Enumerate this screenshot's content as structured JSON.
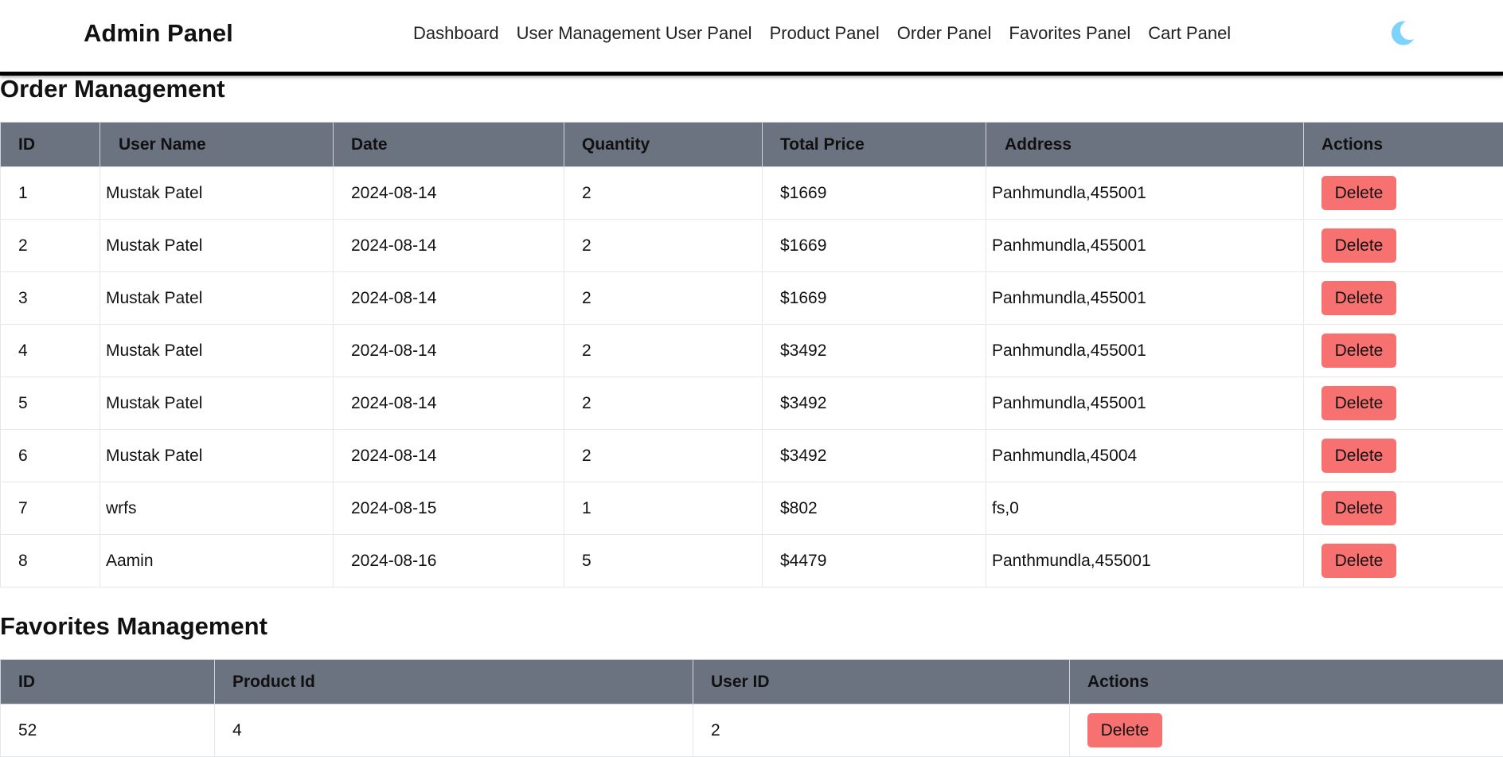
{
  "header": {
    "brand": "Admin Panel",
    "nav": [
      "Dashboard",
      "User Management User Panel",
      "Product Panel",
      "Order Panel",
      "Favorites Panel",
      "Cart Panel"
    ],
    "theme_icon": "moon-icon",
    "theme_color": "#7dd3fc"
  },
  "orders": {
    "title": "Order Management",
    "columns": [
      "ID",
      "User Name",
      "Date",
      "Quantity",
      "Total Price",
      "Address",
      "Actions"
    ],
    "rows": [
      {
        "id": "1",
        "user": "Mustak Patel",
        "date": "2024-08-14",
        "qty": "2",
        "price": "$1669",
        "address": "Panhmundla,455001",
        "action": "Delete"
      },
      {
        "id": "2",
        "user": "Mustak Patel",
        "date": "2024-08-14",
        "qty": "2",
        "price": "$1669",
        "address": "Panhmundla,455001",
        "action": "Delete"
      },
      {
        "id": "3",
        "user": "Mustak Patel",
        "date": "2024-08-14",
        "qty": "2",
        "price": "$1669",
        "address": "Panhmundla,455001",
        "action": "Delete"
      },
      {
        "id": "4",
        "user": "Mustak Patel",
        "date": "2024-08-14",
        "qty": "2",
        "price": "$3492",
        "address": "Panhmundla,455001",
        "action": "Delete"
      },
      {
        "id": "5",
        "user": "Mustak Patel",
        "date": "2024-08-14",
        "qty": "2",
        "price": "$3492",
        "address": "Panhmundla,455001",
        "action": "Delete"
      },
      {
        "id": "6",
        "user": "Mustak Patel",
        "date": "2024-08-14",
        "qty": "2",
        "price": "$3492",
        "address": "Panhmundla,45004",
        "action": "Delete"
      },
      {
        "id": "7",
        "user": "wrfs",
        "date": "2024-08-15",
        "qty": "1",
        "price": "$802",
        "address": "fs,0",
        "action": "Delete"
      },
      {
        "id": "8",
        "user": "Aamin",
        "date": "2024-08-16",
        "qty": "5",
        "price": "$4479",
        "address": "Panthmundla,455001",
        "action": "Delete"
      }
    ]
  },
  "favorites": {
    "title": "Favorites Management",
    "columns": [
      "ID",
      "Product Id",
      "User ID",
      "Actions"
    ],
    "rows": [
      {
        "id": "52",
        "product_id": "4",
        "user_id": "2",
        "action": "Delete"
      }
    ]
  },
  "colors": {
    "header_bg": "#6b7280",
    "delete_bg": "#f87171"
  }
}
